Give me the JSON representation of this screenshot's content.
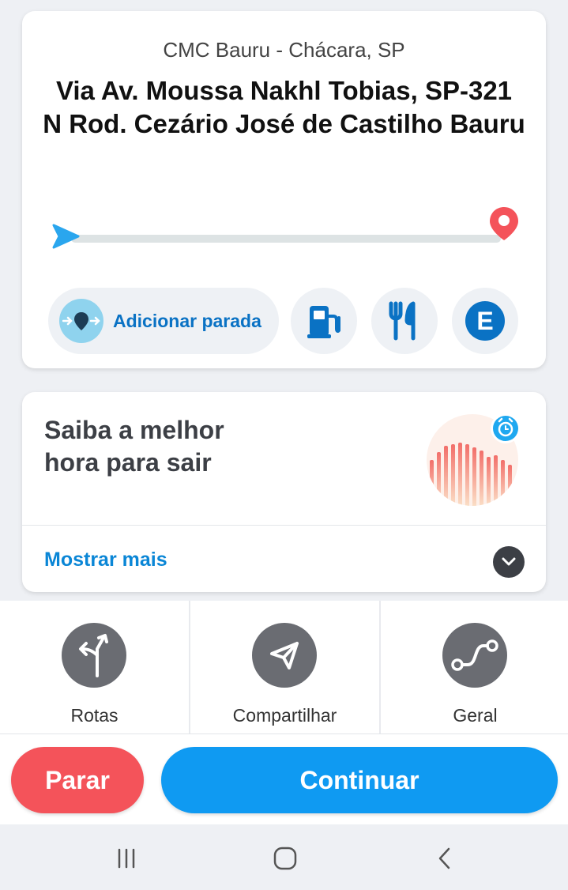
{
  "route": {
    "origin": "CMC Bauru - Chácara, SP",
    "via_line1": "Via Av. Moussa Nakhl Tobias, SP-321",
    "via_line2": "N Rod. Cezário José de Castilho Bauru",
    "add_stop_label": "Adicionar parada",
    "quick_buttons": [
      "gas-station-icon",
      "restaurant-icon",
      "parking-icon"
    ],
    "parking_letter": "E"
  },
  "departure": {
    "title_line1": "Saiba a melhor",
    "title_line2": "hora para sair",
    "show_more": "Mostrar mais"
  },
  "actions": [
    {
      "label": "Rotas",
      "icon": "routes-icon"
    },
    {
      "label": "Compartilhar",
      "icon": "share-icon"
    },
    {
      "label": "Geral",
      "icon": "overview-icon"
    }
  ],
  "buttons": {
    "stop": "Parar",
    "go": "Continuar"
  },
  "colors": {
    "accent_blue": "#0f9af2",
    "stop_red": "#f4535a",
    "link_blue": "#0a86d6",
    "pin_red": "#f4535a"
  }
}
